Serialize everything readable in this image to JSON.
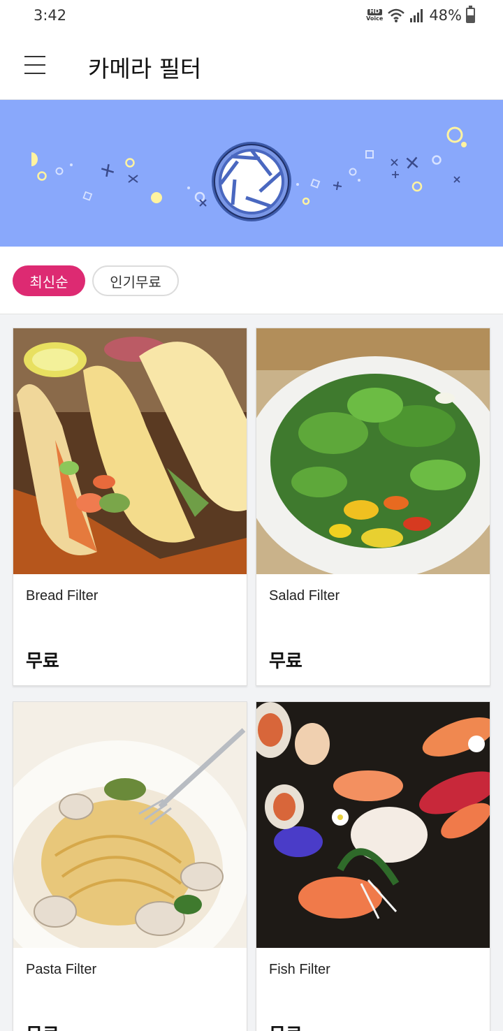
{
  "status": {
    "time": "3:42",
    "hd_label": "HD",
    "voice_label": "Voice",
    "battery": "48%"
  },
  "app_bar": {
    "title": "카메라 필터"
  },
  "sort": {
    "latest": "최신순",
    "popular_free": "인기무료"
  },
  "filters": [
    {
      "name": "Bread Filter",
      "price": "무료"
    },
    {
      "name": "Salad Filter",
      "price": "무료"
    },
    {
      "name": "Pasta Filter",
      "price": "무료"
    },
    {
      "name": "Fish Filter",
      "price": "무료"
    }
  ],
  "colors": {
    "banner": "#89a8fb",
    "accent": "#dd2a72"
  }
}
